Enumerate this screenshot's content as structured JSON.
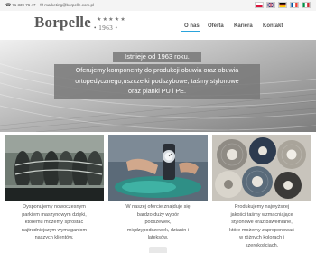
{
  "topbar": {
    "phone": "71 339 76 47",
    "email": "marketing@borpelle.com.pl",
    "languages": [
      "pl",
      "en",
      "de",
      "fr",
      "it"
    ]
  },
  "logo": {
    "name": "Borpelle",
    "stars": "★★★★★",
    "year": "• 1963 •"
  },
  "nav": {
    "items": [
      "O nas",
      "Oferta",
      "Kariera",
      "Kontakt"
    ],
    "active": "O nas",
    "accent_color": "#2aa3db"
  },
  "hero": {
    "title": "Istnieje od 1963 roku.",
    "lines": [
      "Oferujemy komponenty do produkcji obuwia oraz obuwia",
      "ortopedycznego,uszczelki podszybowe, taśmy stylonowe",
      "oraz pianki PU i PE."
    ]
  },
  "columns": [
    {
      "image": "industrial-rollers-machine",
      "lines": [
        "Dysponujemy nowoczesnym",
        "parkiem maszynowym dzięki,",
        "któremu możemy sprostać",
        "najtrudniejszym wymaganiom",
        "naszych klientów."
      ]
    },
    {
      "image": "shoe-insole-inspection",
      "lines": [
        "W naszej ofercie znajduje się",
        "bardzo duży wybór",
        "podszewek,",
        "międzypodszewek, dzianin i",
        "lateksów."
      ]
    },
    {
      "image": "fabric-tape-rolls",
      "lines": [
        "Produkujemy najwyższej",
        "jakości taśmy wzmacniające",
        "stylonowe oraz bawełniane,",
        "które możemy zaproponować",
        "w różnych kolorach i",
        "szerokościach."
      ]
    }
  ]
}
